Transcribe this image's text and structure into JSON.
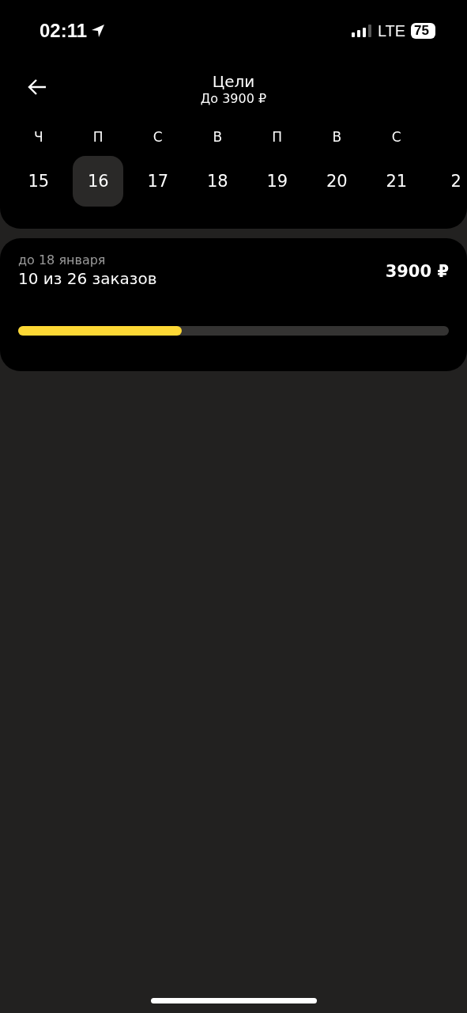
{
  "status_bar": {
    "time": "02:11",
    "network": "LTE",
    "battery": "75"
  },
  "header": {
    "title": "Цели",
    "subtitle": "До 3900 ₽"
  },
  "days": [
    {
      "weekday": "Ч",
      "date": "15",
      "selected": false
    },
    {
      "weekday": "П",
      "date": "16",
      "selected": true
    },
    {
      "weekday": "С",
      "date": "17",
      "selected": false
    },
    {
      "weekday": "В",
      "date": "18",
      "selected": false
    },
    {
      "weekday": "П",
      "date": "19",
      "selected": false
    },
    {
      "weekday": "В",
      "date": "20",
      "selected": false
    },
    {
      "weekday": "С",
      "date": "21",
      "selected": false
    },
    {
      "date": "2",
      "selected": false
    }
  ],
  "goal": {
    "deadline": "до 18 января",
    "progress_text": "10 из 26 заказов",
    "reward": "3900 ₽",
    "level": 0.38
  }
}
